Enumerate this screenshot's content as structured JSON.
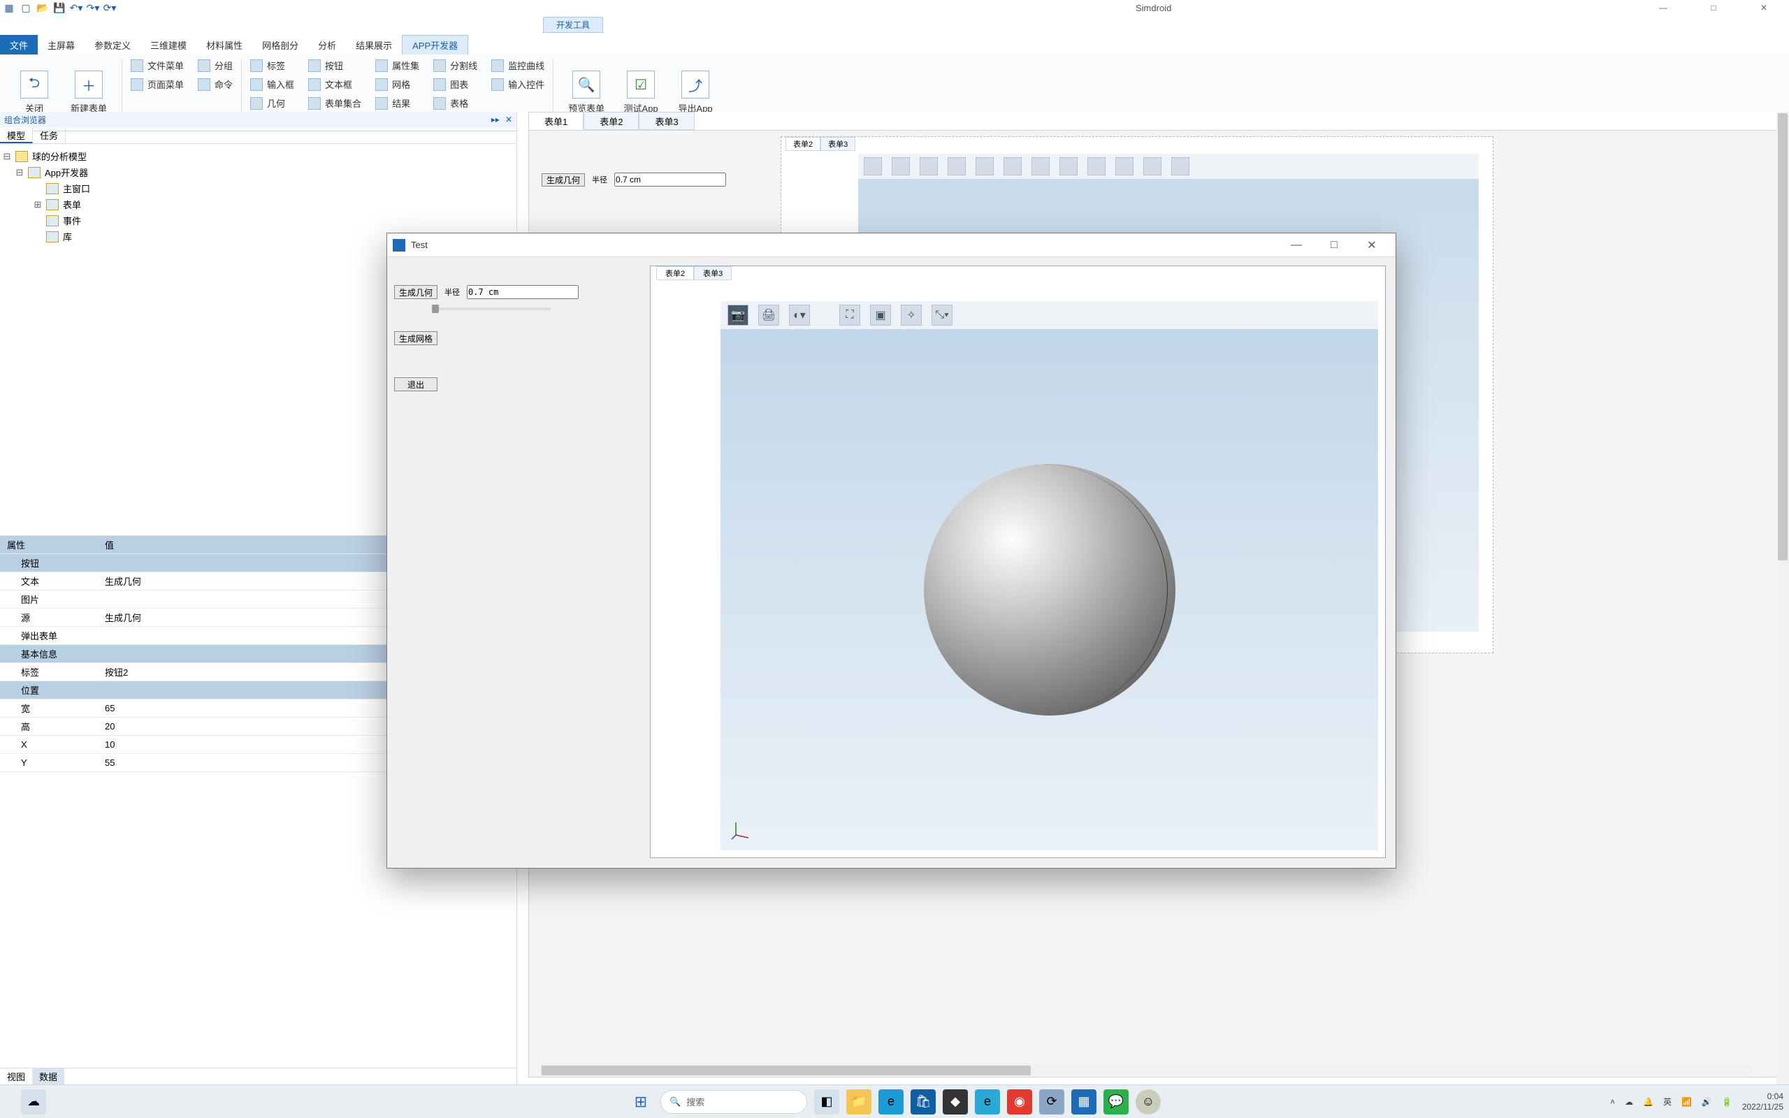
{
  "app_title": "Simdroid",
  "dev_tools": "开发工具",
  "qat_icons": [
    "app-icon",
    "new-icon",
    "open-icon",
    "save-icon",
    "undo-icon",
    "redo-icon",
    "refresh-icon"
  ],
  "win": {
    "min": "—",
    "max": "□",
    "close": "✕"
  },
  "ribbon_tabs": {
    "file": "文件",
    "items": [
      "主屏幕",
      "参数定义",
      "三维建模",
      "材料属性",
      "网格剖分",
      "分析",
      "结果展示",
      "APP开发器"
    ],
    "active": "APP开发器"
  },
  "ribbon": {
    "big": [
      {
        "label": "关闭",
        "icon": "close-door-icon"
      },
      {
        "label": "新建表单",
        "icon": "plus-icon"
      }
    ],
    "col1": [
      {
        "label": "文件菜单"
      },
      {
        "label": "页面菜单"
      }
    ],
    "col2": [
      {
        "label": "分组"
      },
      {
        "label": "命令"
      }
    ],
    "col3": [
      {
        "label": "标签"
      },
      {
        "label": "输入框"
      },
      {
        "label": "几何"
      }
    ],
    "col4": [
      {
        "label": "按钮"
      },
      {
        "label": "文本框"
      },
      {
        "label": "表单集合"
      }
    ],
    "col5": [
      {
        "label": "属性集"
      },
      {
        "label": "网格"
      },
      {
        "label": "结果"
      }
    ],
    "col6": [
      {
        "label": "分割线"
      },
      {
        "label": "图表"
      },
      {
        "label": "表格"
      }
    ],
    "col7": [
      {
        "label": "监控曲线"
      },
      {
        "label": "输入控件"
      }
    ],
    "big2": [
      {
        "label": "预览表单",
        "icon": "magnify-icon"
      },
      {
        "label": "测试App",
        "icon": "checklist-icon"
      },
      {
        "label": "导出App",
        "icon": "export-icon"
      }
    ]
  },
  "browser_title": "组合浏览器",
  "browser_tabs": [
    "模型",
    "任务"
  ],
  "browser_tabs_active": "模型",
  "tree": [
    {
      "lvl": 0,
      "exp": "⊟",
      "label": "球的分析模型",
      "icon": "globe"
    },
    {
      "lvl": 1,
      "exp": "⊟",
      "label": "App开发器",
      "icon": "app"
    },
    {
      "lvl": 2,
      "exp": "",
      "label": "主窗口",
      "icon": "win"
    },
    {
      "lvl": 2,
      "exp": "⊞",
      "label": "表单",
      "icon": "form"
    },
    {
      "lvl": 2,
      "exp": "",
      "label": "事件",
      "icon": "evt"
    },
    {
      "lvl": 2,
      "exp": "",
      "label": "库",
      "icon": "lib"
    }
  ],
  "prop_header": {
    "c1": "属性",
    "c2": "值"
  },
  "props": [
    {
      "type": "grp",
      "c1": "按钮"
    },
    {
      "type": "row",
      "c1": "文本",
      "c2": "生成几何"
    },
    {
      "type": "row",
      "c1": "图片",
      "c2": ""
    },
    {
      "type": "row",
      "c1": "源",
      "c2": "生成几何"
    },
    {
      "type": "row",
      "c1": "弹出表单",
      "c2": ""
    },
    {
      "type": "grp",
      "c1": "基本信息"
    },
    {
      "type": "row",
      "c1": "标签",
      "c2": "按钮2"
    },
    {
      "type": "grp",
      "c1": "位置"
    },
    {
      "type": "row",
      "c1": "宽",
      "c2": "65"
    },
    {
      "type": "row",
      "c1": "高",
      "c2": "20"
    },
    {
      "type": "row",
      "c1": "X",
      "c2": "10"
    },
    {
      "type": "row",
      "c1": "Y",
      "c2": "55"
    }
  ],
  "bottom_tabs": [
    "视图",
    "数据"
  ],
  "bottom_tabs_active": "数据",
  "form_tabs": [
    "表单1",
    "表单2",
    "表单3"
  ],
  "form_tabs_active": "表单1",
  "designer": {
    "btn": "生成几何",
    "radius_label": "半径",
    "radius_value": "0.7 cm",
    "mini_tabs": [
      "表单2",
      "表单3"
    ],
    "mini_active": "表单2"
  },
  "modal": {
    "title": "Test",
    "side": {
      "gen_geom": "生成几何",
      "radius_label": "半径",
      "radius_value": "0.7 cm",
      "gen_mesh": "生成网格",
      "exit": "退出"
    },
    "mtabs": [
      "表单2",
      "表单3"
    ],
    "mactive": "表单2",
    "toolbar_icons": [
      "camera-icon",
      "print-icon",
      "palette-icon",
      "zoom-extents-icon",
      "zoom-box-icon",
      "clear-sel-icon",
      "axis-icon"
    ]
  },
  "taskbar": {
    "search_placeholder": "搜索",
    "apps": [
      "start-icon",
      "search-icon",
      "taskview-icon",
      "explorer-icon",
      "edge-icon",
      "store-icon",
      "blackbox-icon",
      "e-browser-icon",
      "music-icon",
      "thunder-icon",
      "simdroid-icon",
      "wechat-icon",
      "avatar-icon"
    ],
    "tray": [
      "chevron-up-icon",
      "onedrive-icon",
      "security-icon"
    ],
    "ime": "英",
    "wifi": "wifi-icon",
    "vol": "vol-icon",
    "batt": "batt-icon",
    "time": "0:04",
    "date": "2022/11/25"
  }
}
